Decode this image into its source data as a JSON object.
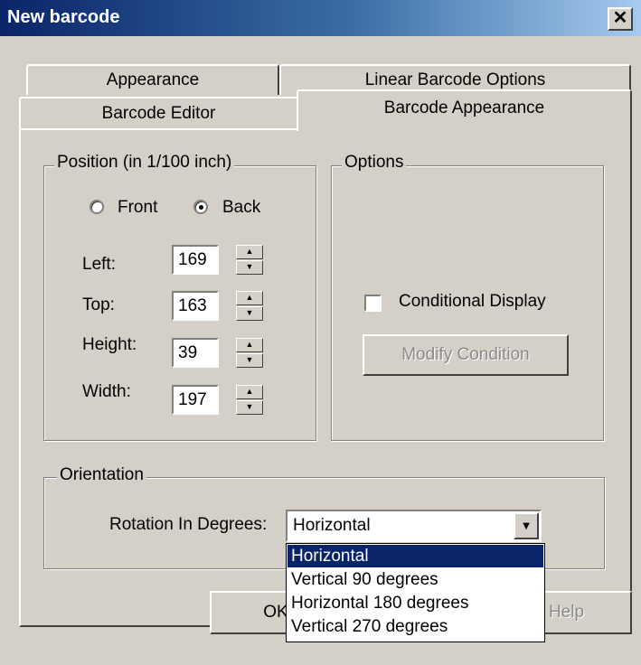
{
  "window": {
    "title": "New barcode",
    "close_glyph": "✕"
  },
  "tabs": {
    "appearance": "Appearance",
    "linear_options": "Linear Barcode Options",
    "barcode_editor": "Barcode Editor",
    "barcode_appearance": "Barcode Appearance",
    "active": "Barcode Appearance"
  },
  "position": {
    "title": "Position (in 1/100 inch)",
    "front_label": "Front",
    "back_label": "Back",
    "selected": "Back",
    "fields": [
      {
        "label": "Left:",
        "value": "169"
      },
      {
        "label": "Top:",
        "value": "163"
      },
      {
        "label": "Height:",
        "value": "39"
      },
      {
        "label": "Width:",
        "value": "197"
      }
    ]
  },
  "options": {
    "title": "Options",
    "conditional_label": "Conditional Display",
    "conditional_checked": false,
    "modify_label": "Modify Condition"
  },
  "orientation": {
    "title": "Orientation",
    "rotation_label": "Rotation In Degrees:",
    "selected": "Horizontal",
    "items": [
      "Horizontal",
      "Vertical 90 degrees",
      "Horizontal 180 degrees",
      "Vertical 270 degrees"
    ]
  },
  "buttons": {
    "ok": "OK",
    "help": "Help"
  },
  "icons": {
    "spin_up": "up-arrow-icon",
    "spin_down": "down-arrow-icon",
    "dropdown": "chevron-down-icon",
    "close": "close-icon"
  },
  "colors": {
    "face": "#d4d0c8",
    "titlebar": "#0a246a",
    "selection": "#0a246a"
  }
}
